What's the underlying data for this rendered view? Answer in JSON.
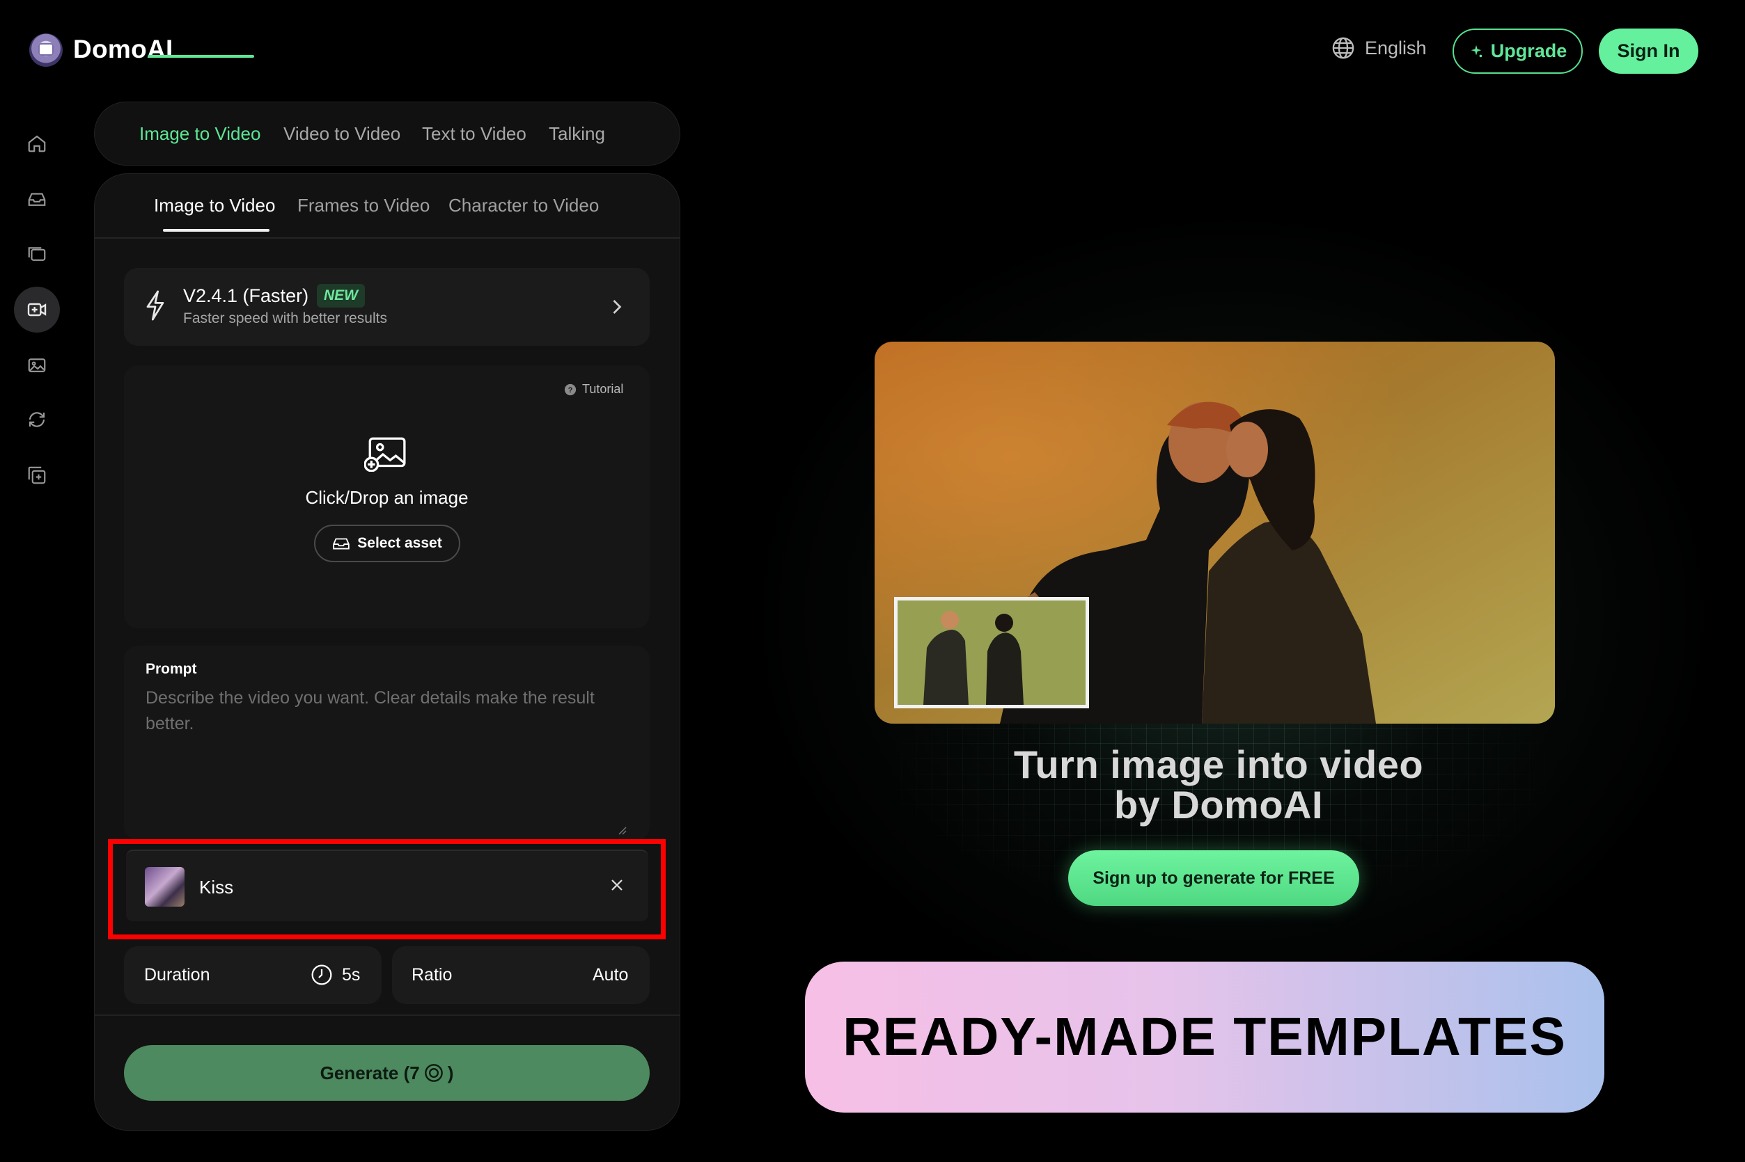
{
  "header": {
    "brand": "DomoAI",
    "language": "English",
    "upgrade_label": "Upgrade",
    "signin_label": "Sign In"
  },
  "sidebar": {
    "items": [
      {
        "name": "home-icon",
        "active": false
      },
      {
        "name": "assets-icon",
        "active": false
      },
      {
        "name": "gallery-icon",
        "active": false
      },
      {
        "name": "video-create-icon",
        "active": true
      },
      {
        "name": "image-icon",
        "active": false
      },
      {
        "name": "convert-icon",
        "active": false
      },
      {
        "name": "template-icon",
        "active": false
      }
    ]
  },
  "main_tabs": [
    "Image to Video",
    "Video to Video",
    "Text to Video",
    "Talking"
  ],
  "sub_tabs": [
    "Image to Video",
    "Frames to Video",
    "Character to Video"
  ],
  "model": {
    "name": "V2.4.1 (Faster)",
    "badge": "NEW",
    "description": "Faster speed with better results"
  },
  "upload": {
    "tutorial": "Tutorial",
    "prompt_text": "Click/Drop an image",
    "select_asset": "Select asset"
  },
  "prompt": {
    "label": "Prompt",
    "placeholder": "Describe the video you want. Clear details make the result better.",
    "value": ""
  },
  "template": {
    "name": "Kiss"
  },
  "options": {
    "duration_label": "Duration",
    "duration_value": "5s",
    "ratio_label": "Ratio",
    "ratio_value": "Auto"
  },
  "generate": {
    "label": "Generate (7",
    "label_end": ")"
  },
  "hero": {
    "title_line1": "Turn image into video",
    "title_line2": "by DomoAI",
    "cta": "Sign up to generate for FREE"
  },
  "banner": {
    "text": "READY-MADE TEMPLATES"
  },
  "colors": {
    "accent": "#5ee695",
    "generate_bg": "#4d8a5f",
    "highlight": "#ff0000"
  }
}
